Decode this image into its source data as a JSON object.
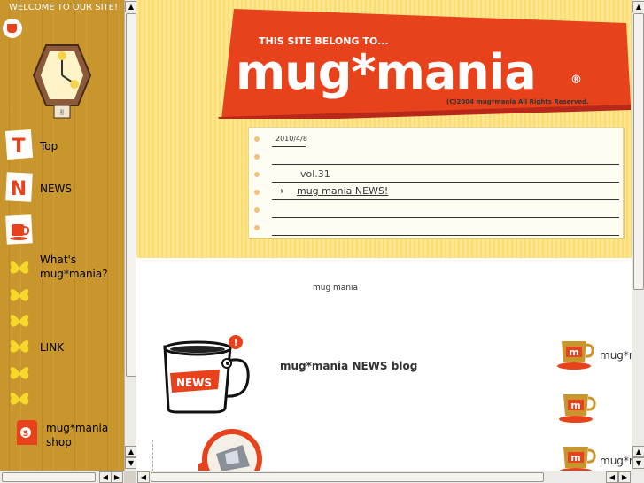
{
  "left": {
    "welcome": "WELCOME TO OUR SITE!",
    "menu": [
      {
        "icon": "T",
        "label": "Top"
      },
      {
        "icon": "N",
        "label": "NEWS"
      },
      {
        "icon": "mug",
        "label": ""
      },
      {
        "icon": "butterfly",
        "label": "What's\nmug*mania?"
      },
      {
        "icon": "butterfly",
        "label": ""
      },
      {
        "icon": "butterfly",
        "label": ""
      },
      {
        "icon": "butterfly",
        "label": "LINK"
      },
      {
        "icon": "butterfly",
        "label": ""
      },
      {
        "icon": "butterfly",
        "label": ""
      },
      {
        "icon": "shop",
        "label": "mug*mania\nshop"
      }
    ]
  },
  "banner": {
    "tagline": "THIS SITE BELONG TO...",
    "logo": "mug*mania",
    "registered": "®",
    "copyright": "(C)2004 mug*mania All Rights Reserved."
  },
  "news_paper": {
    "date": "2010/4/8",
    "volume": "vol.31",
    "arrow": "→",
    "link_label": "mug mania NEWS!"
  },
  "content": {
    "subtitle": "mug  mania",
    "news_badge": "NEWS",
    "blog_title": "mug*mania NEWS  blog",
    "side_items": [
      {
        "badge": "m",
        "label": "mug*mania"
      },
      {
        "badge": "m",
        "label": ""
      },
      {
        "badge": "m",
        "label": "mug*mania"
      }
    ]
  },
  "colors": {
    "left_bg": "#c8962c",
    "header_bg": "#fde68f",
    "brand_red": "#e8421c"
  }
}
